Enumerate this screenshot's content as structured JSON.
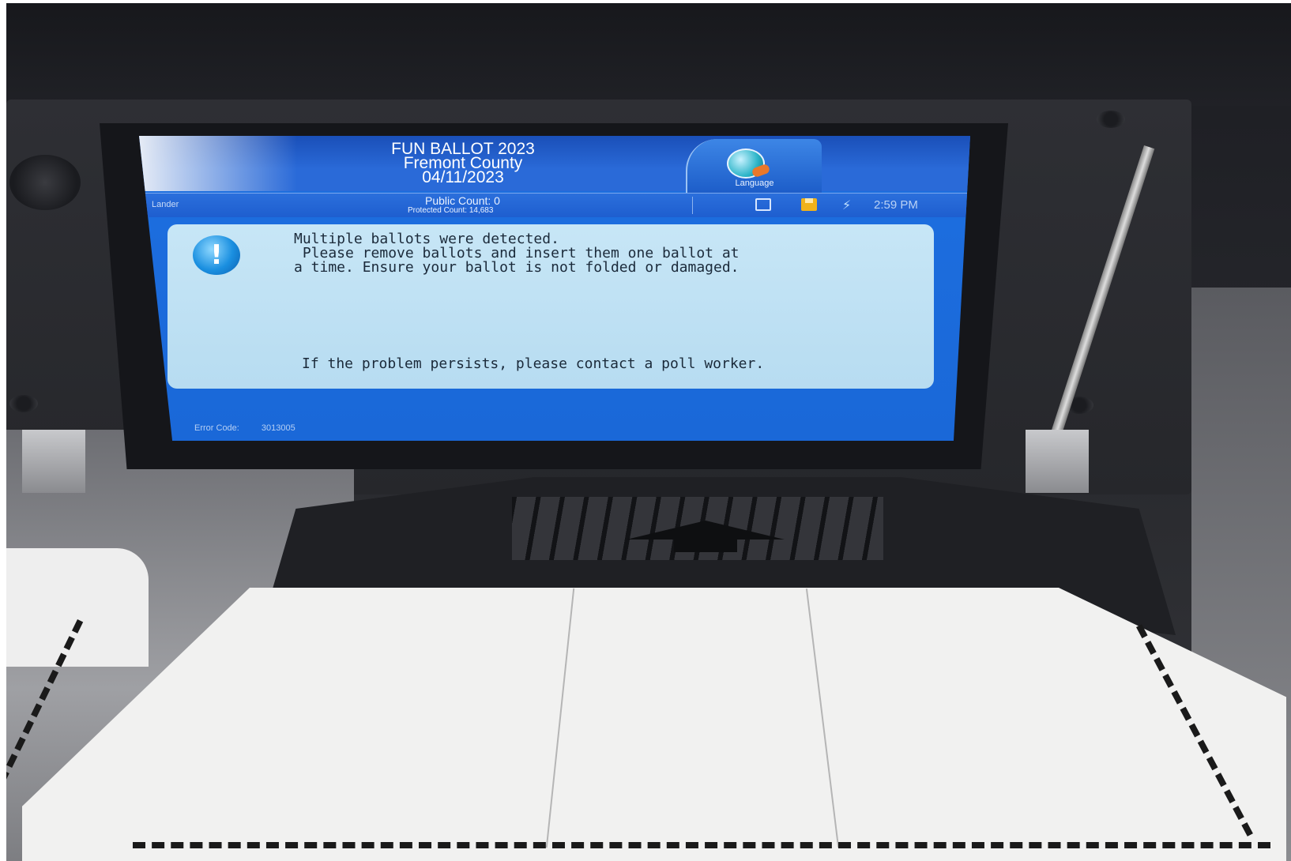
{
  "header": {
    "title_line1": "FUN BALLOT 2023",
    "title_line2": "Fremont County",
    "title_line3": "04/11/2023",
    "language_label": "Language"
  },
  "status": {
    "location": "Lander",
    "public_count": "Public Count: 0",
    "protected_count": "Protected Count: 14,683",
    "time": "2:59 PM",
    "icons": [
      "print-icon",
      "save-icon",
      "power-icon"
    ]
  },
  "message": {
    "icon": "exclamation-icon",
    "text": "Multiple ballots were detected.\n Please remove ballots and insert them one ballot at\na time. Ensure your ballot is not folded or damaged.",
    "footer": "If the problem persists, please contact a poll worker."
  },
  "error": {
    "label": "Error Code:",
    "code": "3013005"
  },
  "colors": {
    "screen_blue": "#1d6fe0",
    "message_bg": "#c7e6f6",
    "save_icon": "#f0b21a"
  }
}
